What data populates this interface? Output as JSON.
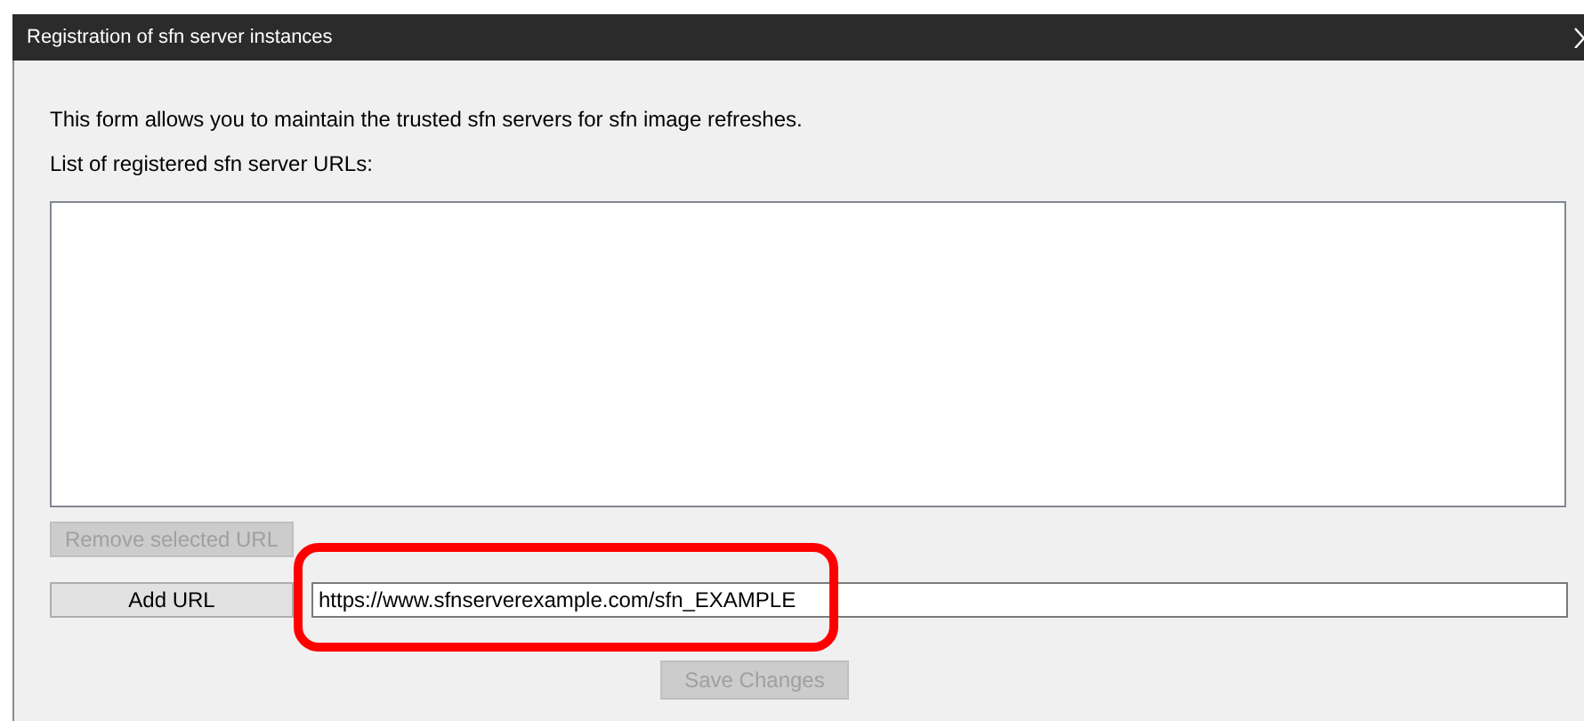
{
  "window": {
    "title": "Registration of sfn server instances",
    "closable": true
  },
  "intro": "This form allows you to maintain the trusted sfn servers for sfn image refreshes.",
  "list_label": "List of registered sfn server URLs:",
  "remove_button": {
    "label": "Remove selected URL",
    "disabled": true
  },
  "add_button": {
    "label": "Add URL",
    "disabled": false
  },
  "url_field": {
    "value": "https://www.sfnserverexample.com/sfn_EXAMPLE",
    "highlighted": true
  },
  "save_button": {
    "label": "Save Changes",
    "disabled": true
  }
}
